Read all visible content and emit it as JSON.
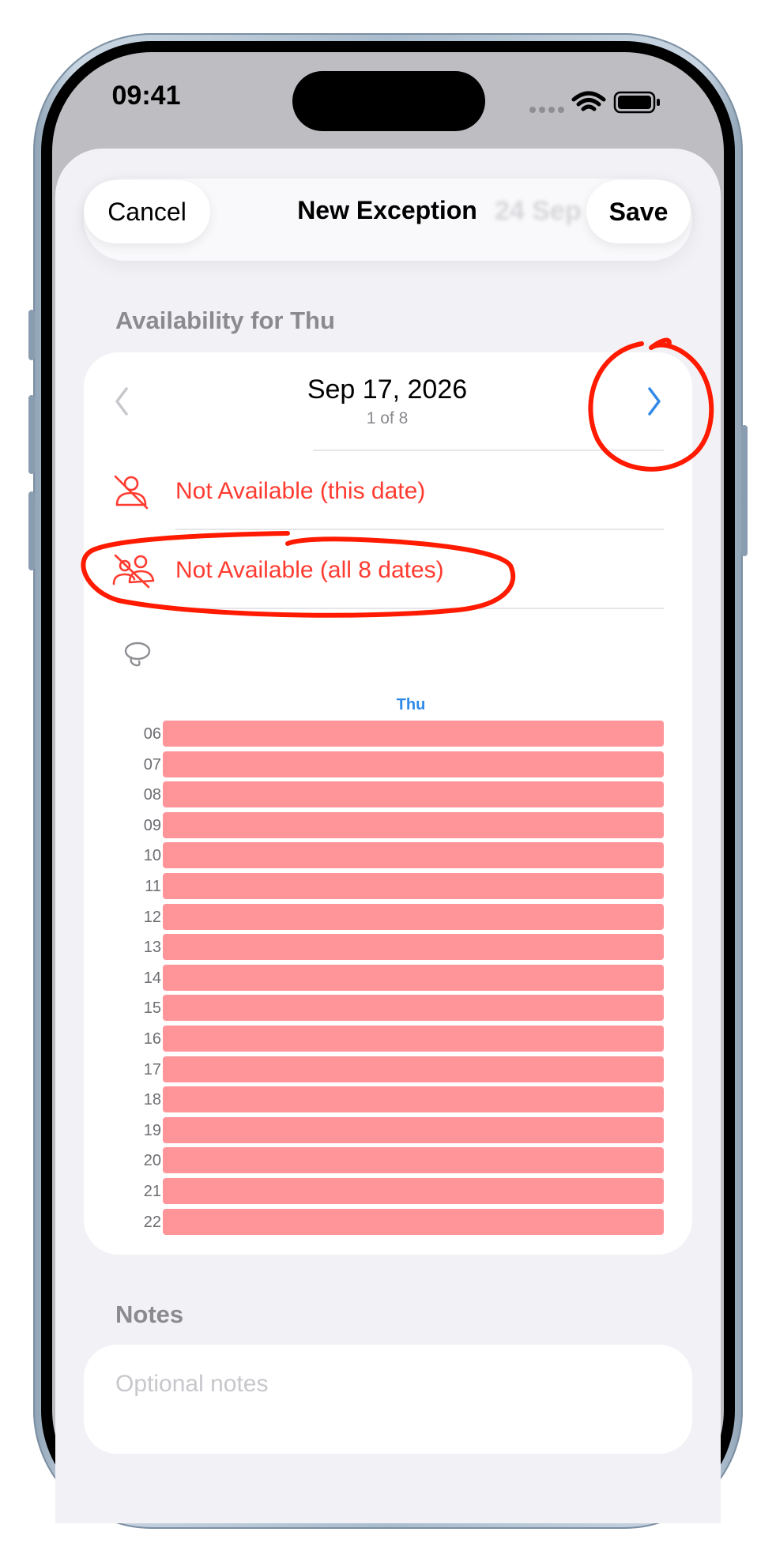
{
  "status_bar": {
    "time": "09:41"
  },
  "nav": {
    "cancel_label": "Cancel",
    "title": "New Exception",
    "save_label": "Save",
    "background_date": "24 Sep 2"
  },
  "availability": {
    "section_title": "Availability for Thu",
    "date_title": "Sep 17, 2026",
    "date_position": "1 of 8",
    "options": [
      {
        "label": "Not Available (this date)",
        "icon": "person-slash-icon"
      },
      {
        "label": "Not Available (all 8 dates)",
        "icon": "people-slash-icon"
      }
    ],
    "lasso_icon": "lasso-icon",
    "day_header": "Thu",
    "hours": [
      "06",
      "07",
      "08",
      "09",
      "10",
      "11",
      "12",
      "13",
      "14",
      "15",
      "16",
      "17",
      "18",
      "19",
      "20",
      "21",
      "22"
    ],
    "slot_color": "#ff9499"
  },
  "notes": {
    "section_title": "Notes",
    "placeholder": "Optional notes"
  },
  "colors": {
    "accent_blue": "#2f8ae8",
    "destructive_red": "#ff3b30",
    "annotation_red": "#ff1a00"
  }
}
